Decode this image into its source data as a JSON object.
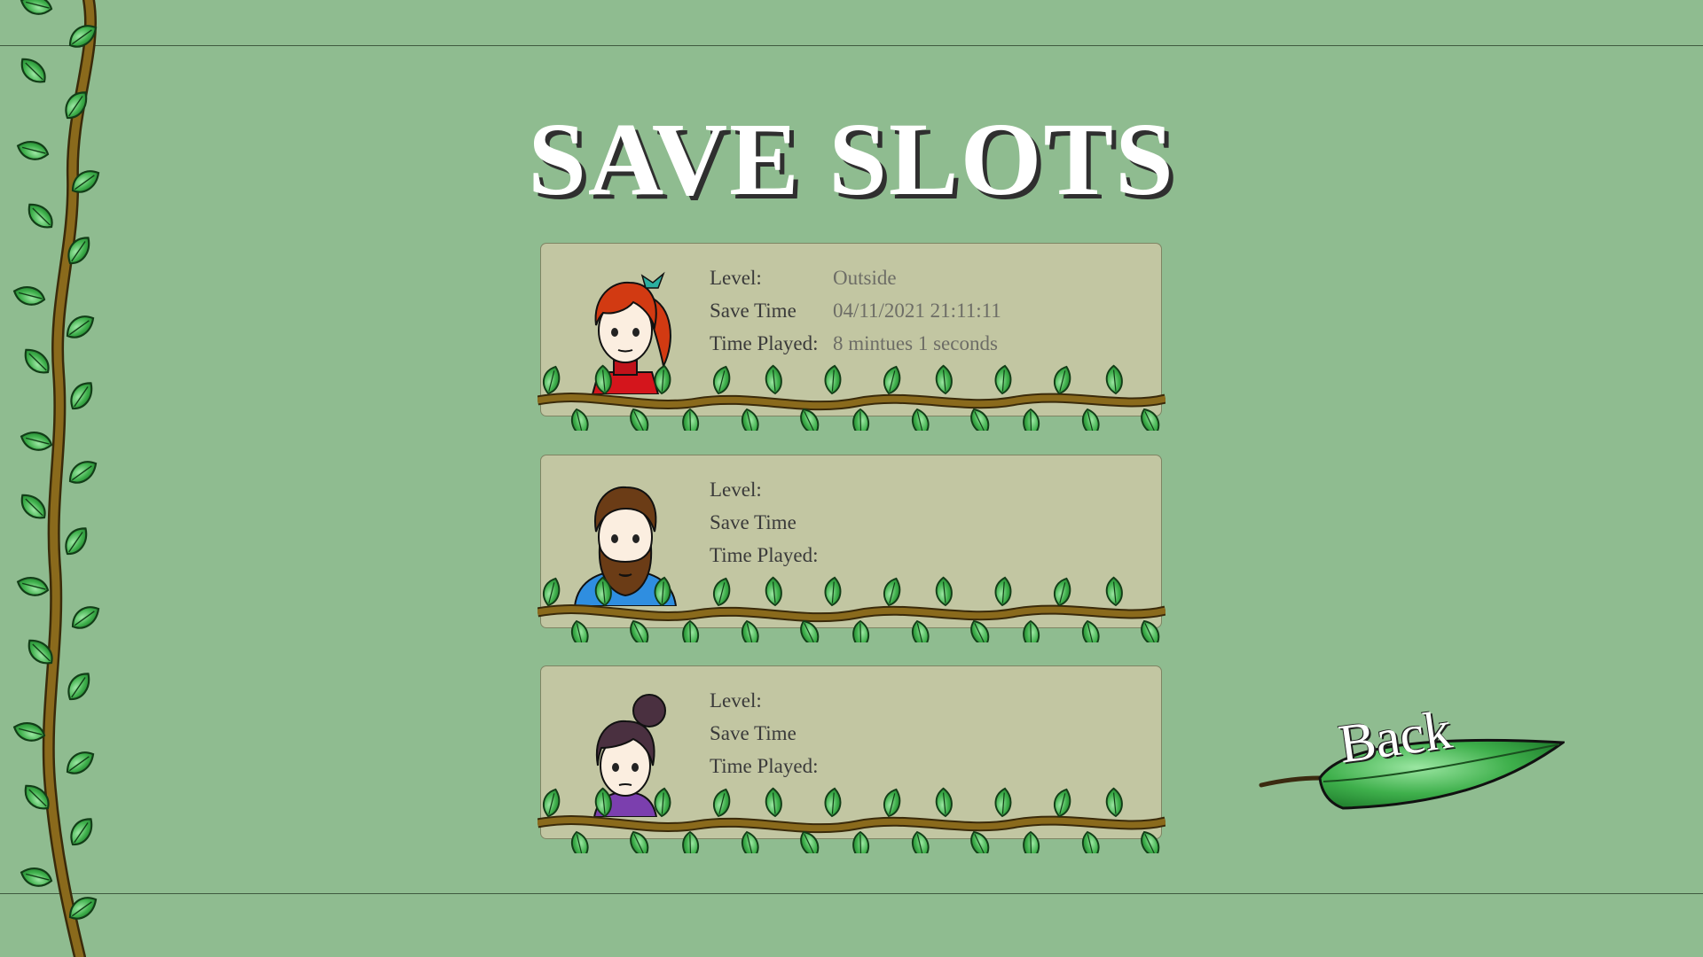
{
  "title": "SAVE SLOTS",
  "slots": [
    {
      "character": "red-ponytail-girl",
      "level_label": "Level:",
      "level": "Outside",
      "save_time_label": "Save Time",
      "save_time": "04/11/2021 21:11:11",
      "time_played_label": "Time Played:",
      "time_played": "8 mintues 1 seconds"
    },
    {
      "character": "bearded-man",
      "level_label": "Level:",
      "level": "",
      "save_time_label": "Save Time",
      "save_time": "",
      "time_played_label": "Time Played:",
      "time_played": ""
    },
    {
      "character": "bun-hair-woman",
      "level_label": "Level:",
      "level": "",
      "save_time_label": "Save Time",
      "save_time": "",
      "time_played_label": "Time Played:",
      "time_played": ""
    }
  ],
  "back_button": {
    "label": "Back",
    "icon": "leaf-icon"
  },
  "colors": {
    "background": "#8fbc90",
    "slot_fill": "#c2c6a2",
    "leaf": "#3fae4c",
    "vine": "#8a6a1c"
  }
}
